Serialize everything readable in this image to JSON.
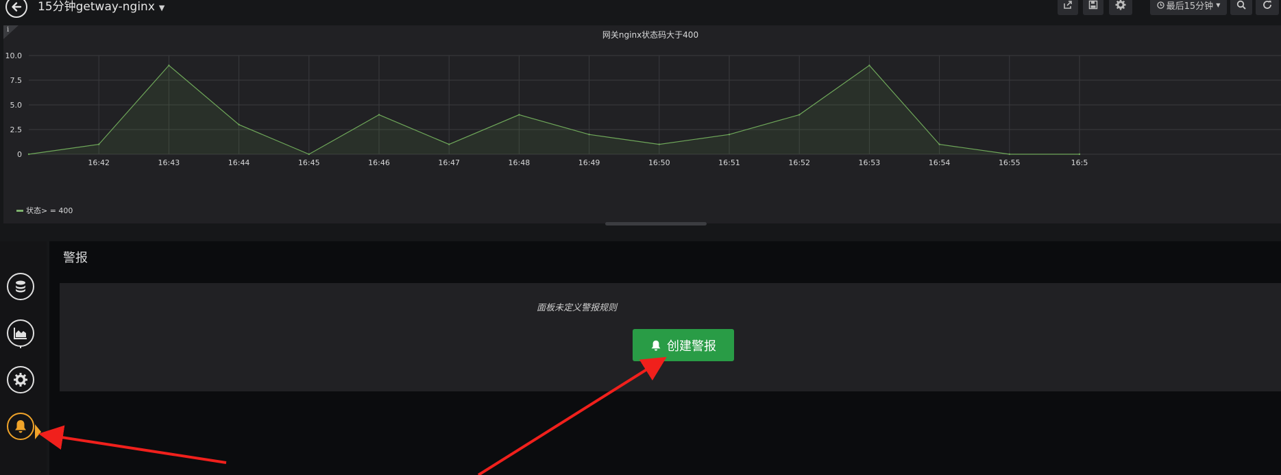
{
  "header": {
    "dashboard_title": "15分钟getway-nginx",
    "time_picker_label": "最后15分钟",
    "toolbar_icons": [
      "share-icon",
      "save-icon",
      "gear-icon",
      "clock-icon",
      "zoom-out-icon",
      "refresh-icon"
    ]
  },
  "panel": {
    "info_symbol": "i",
    "title": "网关nginx状态码大于400",
    "legend_label": "状态> = 400"
  },
  "chart_data": {
    "type": "area",
    "title": "网关nginx状态码大于400",
    "x": [
      "16:41",
      "16:42",
      "16:43",
      "16:44",
      "16:45",
      "16:46",
      "16:47",
      "16:48",
      "16:49",
      "16:50",
      "16:51",
      "16:52",
      "16:53",
      "16:54",
      "16:55",
      "16:56"
    ],
    "x_tick_labels": [
      "16:42",
      "16:43",
      "16:44",
      "16:45",
      "16:46",
      "16:47",
      "16:48",
      "16:49",
      "16:50",
      "16:51",
      "16:52",
      "16:53",
      "16:54",
      "16:55",
      "16:5"
    ],
    "y_tick_labels": [
      "0",
      "2.5",
      "5.0",
      "7.5",
      "10.0"
    ],
    "ylim": [
      0,
      10
    ],
    "grid": true,
    "legend_position": "bottom-left",
    "series": [
      {
        "name": "状态> = 400",
        "color": "#629e51",
        "values": [
          0,
          1,
          9,
          3,
          0,
          4,
          1,
          4,
          2,
          1,
          2,
          4,
          9,
          1,
          0,
          0
        ]
      }
    ]
  },
  "sidebar": {
    "steps": [
      {
        "icon": "database-icon",
        "active": false
      },
      {
        "icon": "area-chart-icon",
        "active": false
      },
      {
        "icon": "settings-icon",
        "active": false
      },
      {
        "icon": "bell-icon",
        "active": true
      }
    ]
  },
  "alert_tab": {
    "title": "警报",
    "empty_message": "面板未定义警报规则",
    "create_button_label": "创建警报"
  },
  "colors": {
    "accent_active": "#f0a42a",
    "create_button": "#299c46",
    "annotation_arrow": "#f0201c"
  }
}
